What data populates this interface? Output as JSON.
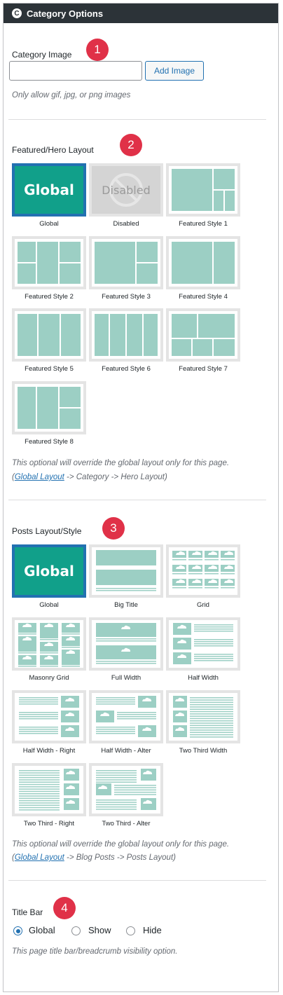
{
  "header": {
    "title": "Category Options",
    "logo_icon": "c-logo-icon"
  },
  "badges": [
    "1",
    "2",
    "3",
    "4"
  ],
  "category_image": {
    "label": "Category Image",
    "input_value": "",
    "button_label": "Add Image",
    "help": "Only allow gif, jpg, or png images"
  },
  "hero": {
    "label": "Featured/Hero Layout",
    "tile_text": {
      "global": "Global",
      "disabled": "Disabled"
    },
    "options": [
      "Global",
      "Disabled",
      "Featured Style 1",
      "Featured Style 2",
      "Featured Style 3",
      "Featured Style 4",
      "Featured Style 5",
      "Featured Style 6",
      "Featured Style 7",
      "Featured Style 8"
    ],
    "selected": "Global",
    "note_line1": "This optional will override the global layout only for this page.",
    "note_paren_open": "(",
    "note_link": "Global Layout",
    "note_rest": " -> Category -> Hero Layout)"
  },
  "posts": {
    "label": "Posts Layout/Style",
    "tile_text": {
      "global": "Global"
    },
    "options": [
      "Global",
      "Big Title",
      "Grid",
      "Masonry Grid",
      "Full Width",
      "Half Width",
      "Half Width - Right",
      "Half Width - Alter",
      "Two Third Width",
      "Two Third - Right",
      "Two Third - Alter"
    ],
    "selected": "Global",
    "note_line1": "This optional will override the global layout only for this page.",
    "note_paren_open": "(",
    "note_link": "Global Layout",
    "note_rest": " -> Blog Posts -> Posts Layout)"
  },
  "title_bar": {
    "label": "Title Bar",
    "options": [
      "Global",
      "Show",
      "Hide"
    ],
    "selected": "Global",
    "help": "This page title bar/breadcrumb visibility option."
  },
  "colors": {
    "accent": "#2271b1",
    "teal": "#11a08a",
    "mint": "#9ccfc4",
    "badge": "#e03148",
    "header_bg": "#2c3338"
  }
}
